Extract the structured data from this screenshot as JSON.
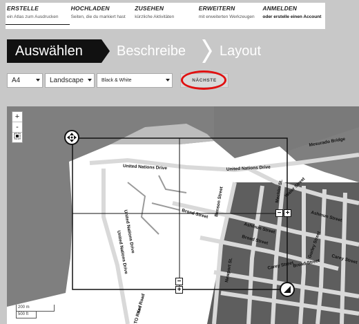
{
  "nav": {
    "items": [
      {
        "title": "ERSTELLE",
        "sub": "ein Atlas zum Ausdrucken"
      },
      {
        "title": "HOCHLADEN",
        "sub": "Seiten, die du markiert hast"
      },
      {
        "title": "ZUSEHEN",
        "sub": "kürzliche Aktivitäten"
      },
      {
        "title": "ERWEITERN",
        "sub": "mit erweiterten Werkzeugen"
      },
      {
        "title": "ANMELDEN",
        "sub": "oder erstelle einen Account"
      }
    ]
  },
  "steps": {
    "step1": "Auswählen",
    "step2": "Beschreibe",
    "step3": "Layout"
  },
  "controls": {
    "paper": "A4",
    "orientation": "Landscape",
    "style": "Black & White",
    "next_label": "NÄCHSTE"
  },
  "map": {
    "zoom_in": "+",
    "zoom_out": "-",
    "select_icon": "select-area-icon",
    "scale_m": "200 m",
    "scale_ft": "500 ft",
    "labels": {
      "un_drive_top": "United Nations Drive",
      "un_drive_right": "United Nations Drive",
      "un_drive_left1": "United Nations Drive",
      "un_drive_left2": "United Nations Drive",
      "mesurado": "Mesurado Bridge",
      "broad1": "Broad Street",
      "broad2": "Broad Street",
      "broad3": "Broad Street",
      "ashmun1": "Ashmun Street",
      "ashmun2": "Ashmun Street",
      "carey1": "Carey Street",
      "carey2": "Carey Street",
      "gurley": "Gurley Street",
      "benson": "Benson Street",
      "newport": "Newport St.",
      "mechlin": "Mechlin St.",
      "water": "Water Street",
      "to": "TO Road",
      "kro": "Kro Road"
    }
  },
  "colors": {
    "highlight": "#e01010",
    "active_step": "#111111"
  }
}
